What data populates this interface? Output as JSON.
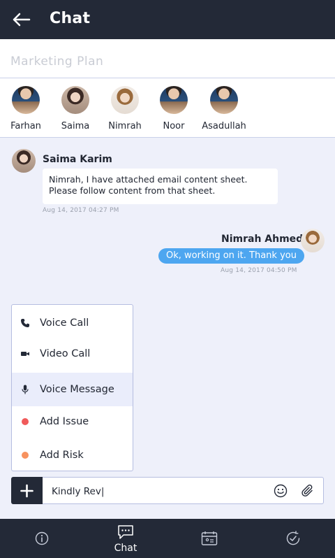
{
  "header": {
    "title": "Chat",
    "back_icon": "arrow-left-icon"
  },
  "subject": {
    "text": "Marketing Plan"
  },
  "members": [
    {
      "name": "Farhan"
    },
    {
      "name": "Saima"
    },
    {
      "name": "Nimrah"
    },
    {
      "name": "Noor"
    },
    {
      "name": "Asadullah"
    }
  ],
  "messages": [
    {
      "sender": "Saima Karim",
      "text": "Nimrah, I have attached email content sheet. Please follow content from that sheet.",
      "time": "Aug 14, 2017  04:27 PM",
      "direction": "incoming"
    },
    {
      "sender": "Nimrah Ahmed",
      "text": "Ok, working on it. Thank you",
      "time": "Aug 14, 2017  04:50 PM",
      "direction": "outgoing"
    }
  ],
  "menu": {
    "items": [
      {
        "label": "Voice Call",
        "icon": "phone-icon"
      },
      {
        "label": "Video Call",
        "icon": "video-camera-icon"
      },
      {
        "label": "Voice Message",
        "icon": "microphone-icon",
        "active": true
      },
      {
        "label": "Add Issue",
        "icon": "red-dot-icon",
        "color": "#f05a5a"
      },
      {
        "label": "Add Risk",
        "icon": "orange-dot-icon",
        "color": "#f7925f"
      }
    ]
  },
  "composer": {
    "value": "Kindly Rev|",
    "plus_icon": "plus-icon",
    "emoji_icon": "smiley-icon",
    "attach_icon": "paperclip-icon"
  },
  "bottom_nav": {
    "tabs": [
      {
        "label": "",
        "icon": "info-icon"
      },
      {
        "label": "Chat",
        "icon": "chat-bubble-icon",
        "active": true
      },
      {
        "label": "",
        "icon": "calendar-icon"
      },
      {
        "label": "",
        "icon": "activity-clock-icon"
      }
    ]
  },
  "colors": {
    "dark": "#232937",
    "accent": "#4da6f0",
    "background": "#eef0fa"
  }
}
